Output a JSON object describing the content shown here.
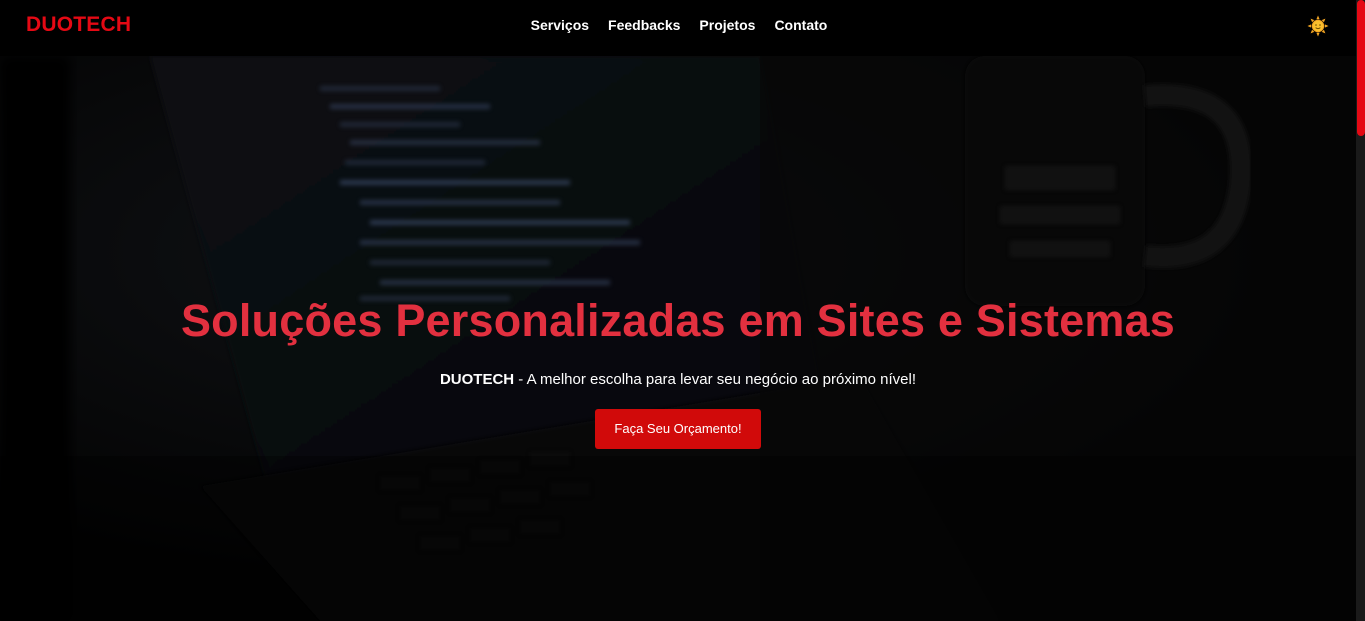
{
  "header": {
    "logo": "DUOTECH",
    "nav": [
      "Serviços",
      "Feedbacks",
      "Projetos",
      "Contato"
    ],
    "theme_icon": "sun-icon"
  },
  "hero": {
    "title": "Soluções Personalizadas em Sites e Sistemas",
    "subtitle_brand": "DUOTECH",
    "subtitle_rest": " - A melhor escolha para levar seu negócio ao próximo nível!",
    "cta_label": "Faça Seu Orçamento!",
    "background": "laptop-with-code-and-mug-photo"
  },
  "colors": {
    "accent": "#e50914",
    "title": "#e2303f",
    "button": "#d10a0a",
    "header_bg": "#000000"
  }
}
